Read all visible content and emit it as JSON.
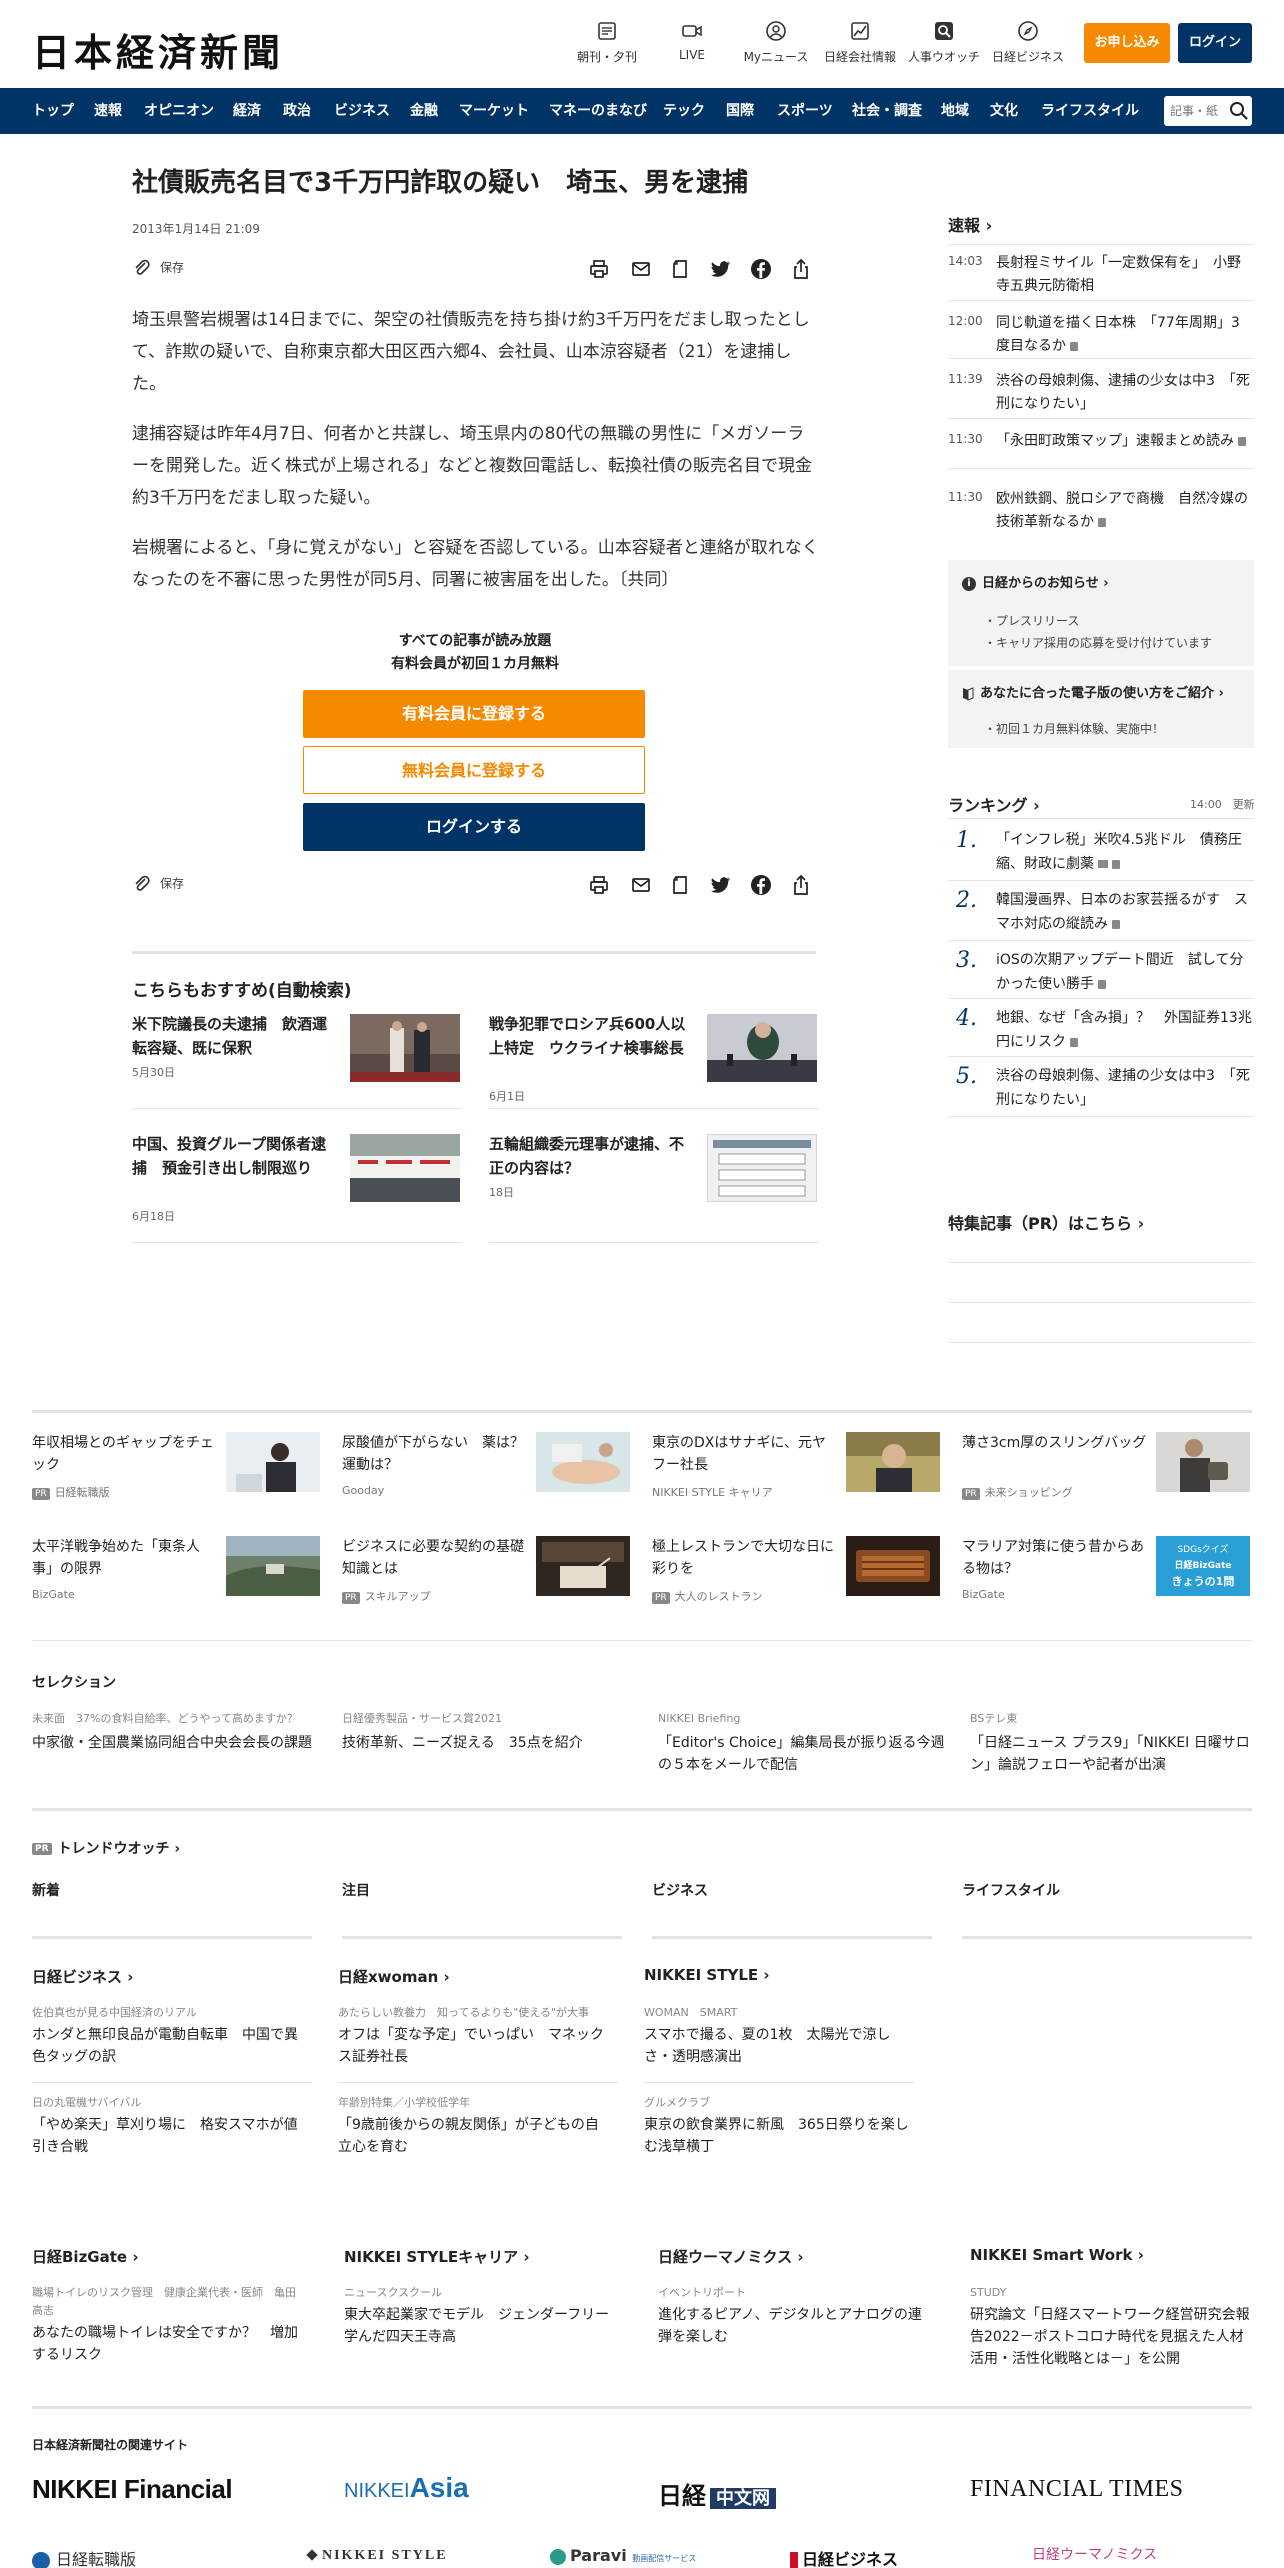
{
  "header": {
    "logo": "日本経済新聞",
    "icons": [
      {
        "label": "朝刊・夕刊",
        "icon": "newspaper-icon"
      },
      {
        "label": "LIVE",
        "icon": "video-icon"
      },
      {
        "label": "Myニュース",
        "icon": "user-icon"
      },
      {
        "label": "日経会社情報",
        "icon": "chart-icon"
      },
      {
        "label": "人事ウオッチ",
        "icon": "search-person-icon"
      },
      {
        "label": "日経ビジネス",
        "icon": "compass-icon"
      }
    ],
    "apply_label": "お申し込み",
    "login_label": "ログイン"
  },
  "nav": {
    "items": [
      "トップ",
      "速報",
      "オピニオン",
      "経済",
      "政治",
      "ビジネス",
      "金融",
      "マーケット",
      "マネーのまなび",
      "テック",
      "国際",
      "スポーツ",
      "社会・調査",
      "地域",
      "文化",
      "ライフスタイル"
    ],
    "search_placeholder": "記事・紙"
  },
  "article": {
    "title": "社債販売名目で3千万円詐取の疑い　埼玉、男を逮捕",
    "date": "2013年1月14日 21:09",
    "save_label": "保存",
    "paragraphs": [
      "埼玉県警岩槻署は14日までに、架空の社債販売を持ち掛け約3千万円をだまし取ったとして、詐欺の疑いで、自称東京都大田区西六郷4、会社員、山本涼容疑者（21）を逮捕した。",
      "逮捕容疑は昨年4月7日、何者かと共謀し、埼玉県内の80代の無職の男性に「メガソーラーを開発した。近く株式が上場される」などと複数回電話し、転換社債の販売名目で現金約3千万円をだまし取った疑い。",
      "岩槻署によると、「身に覚えがない」と容疑を否認している。山本容疑者と連絡が取れなくなったのを不審に思った男性が同5月、同署に被害届を出した。〔共同〕"
    ],
    "paywall_line1": "すべての記事が読み放題",
    "paywall_line2": "有料会員が初回１カ月無料",
    "paid_signup": "有料会員に登録する",
    "free_signup": "無料会員に登録する",
    "login": "ログインする"
  },
  "recommend": {
    "heading": "こちらもおすすめ(自動検索)",
    "items": [
      {
        "title": "米下院議長の夫逮捕　飲酒運転容疑、既に保釈",
        "date": "5月30日"
      },
      {
        "title": "戦争犯罪でロシア兵600人以上特定　ウクライナ検事総長",
        "date": "6月1日"
      },
      {
        "title": "中国、投資グループ関係者逮捕　預金引き出し制限巡り",
        "date": "6月18日"
      },
      {
        "title": "五輪組織委元理事が逮捕、不正の内容は？",
        "date": "18日"
      }
    ]
  },
  "sidebar": {
    "breaking_heading": "速報",
    "breaking": [
      {
        "time": "14:03",
        "text": "長射程ミサイル「一定数保有を」　小野寺五典元防衛相"
      },
      {
        "time": "12:00",
        "text": "同じ軌道を描く日本株　「77年周期」3度目なるか"
      },
      {
        "time": "11:39",
        "text": "渋谷の母娘刺傷、逮捕の少女は中3　「死刑になりたい」"
      },
      {
        "time": "11:30",
        "text": "「永田町政策マップ」速報まとめ読み"
      },
      {
        "time": "11:30",
        "text": "欧州鉄鋼、脱ロシアで商機　自然冷媒の技術革新なるか"
      }
    ],
    "notice_heading": "日経からのお知らせ",
    "notices": [
      "プレスリリース",
      "キャリア採用の応募を受け付けています"
    ],
    "edition_heading": "あなたに合った電子版の使い方をご紹介",
    "edition_items": [
      "初回１カ月無料体験、実施中！"
    ],
    "ranking_heading": "ランキング",
    "ranking_time": "14:00",
    "ranking_update": "更新",
    "ranking": [
      {
        "n": "1.",
        "text": "「インフレ税」米吹4.5兆ドル　債務圧縮、財政に劇薬"
      },
      {
        "n": "2.",
        "text": "韓国漫画界、日本のお家芸揺るがす　スマホ対応の縦読み"
      },
      {
        "n": "3.",
        "text": "iOSの次期アップデート間近　試して分かった使い勝手"
      },
      {
        "n": "4.",
        "text": "地銀、なぜ「含み損」？　外国証券13兆円にリスク"
      },
      {
        "n": "5.",
        "text": "渋谷の母娘刺傷、逮捕の少女は中3　「死刑になりたい」"
      }
    ],
    "pr_heading": "特集記事（PR）はこちら"
  },
  "ads": [
    {
      "title": "年収相場とのギャップをチェック",
      "source": "日経転職版",
      "pr": true
    },
    {
      "title": "尿酸値が下がらない　薬は？運動は？",
      "source": "Gooday",
      "pr": false
    },
    {
      "title": "東京のDXはサナギに、元ヤフー社長",
      "source": "NIKKEI STYLE キャリア",
      "pr": false
    },
    {
      "title": "薄さ3cm厚のスリングバッグ",
      "source": "未来ショッピング",
      "pr": true
    },
    {
      "title": "太平洋戦争始めた「東条人事」の限界",
      "source": "BizGate",
      "pr": false
    },
    {
      "title": "ビジネスに必要な契約の基礎知識とは",
      "source": "スキルアップ",
      "pr": true
    },
    {
      "title": "極上レストランで大切な日に彩りを",
      "source": "大人のレストラン",
      "pr": true
    },
    {
      "title": "マラリア対策に使う昔からある物は？",
      "source": "BizGate",
      "pr": false
    }
  ],
  "ad_badge": "PR",
  "ad_image_text": [
    "SDGsクイズ",
    "日経BizGate",
    "きょうの1問"
  ],
  "selection": {
    "heading": "セレクション",
    "items": [
      {
        "kicker": "未来面　37%の食料自給率、どうやって高めますか？",
        "title": "中家徹・全国農業協同組合中央会会長の課題"
      },
      {
        "kicker": "日経優秀製品・サービス賞2021",
        "title": "技術革新、ニーズ捉える　35点を紹介"
      },
      {
        "kicker": "NIKKEI Briefing",
        "title": "「Editor's Choice」編集局長が振り返る今週の５本をメールで配信"
      },
      {
        "kicker": "BSテレ東",
        "title": "「日経ニュース プラス9」「NIKKEI 日曜サロン」論説フェローや記者が出演"
      }
    ]
  },
  "trend": {
    "badge": "PR",
    "heading": "トレンドウオッチ",
    "columns": [
      "新着",
      "注目",
      "ビジネス",
      "ライフスタイル"
    ]
  },
  "blocks1": [
    {
      "heading": "日経ビジネス",
      "items": [
        {
          "kicker": "佐伯真也が見る中国経済のリアル",
          "title": "ホンダと無印良品が電動自転車　中国で異色タッグの訳"
        },
        {
          "kicker": "日の丸電機サバイバル",
          "title": "「やめ楽天」草刈り場に　格安スマホが値引き合戦"
        }
      ]
    },
    {
      "heading": "日経xwoman",
      "items": [
        {
          "kicker": "あたらしい教養力　知ってるよりも\"使える\"が大事",
          "title": "オフは「変な予定」でいっぱい　マネックス証券社長"
        },
        {
          "kicker": "年齢別特集／小学校低学年",
          "title": "「9歳前後からの親友関係」が子どもの自立心を育む"
        }
      ]
    },
    {
      "heading": "NIKKEI STYLE",
      "items": [
        {
          "kicker": "WOMAN　SMART",
          "title": "スマホで撮る、夏の1枚　太陽光で涼しさ・透明感演出"
        },
        {
          "kicker": "グルメクラブ",
          "title": "東京の飲食業界に新風　365日祭りを楽しむ浅草横丁"
        }
      ]
    }
  ],
  "blocks2": [
    {
      "heading": "日経BizGate",
      "kicker": "職場トイレのリスク管理　健康企業代表・医師　亀田高志",
      "title": "あなたの職場トイレは安全ですか？　増加するリスク"
    },
    {
      "heading": "NIKKEI STYLEキャリア",
      "kicker": "ニュースクスクール",
      "title": "東大卒起業家でモデル　ジェンダーフリー学んだ四天王寺高"
    },
    {
      "heading": "日経ウーマノミクス",
      "kicker": "イベントリポート",
      "title": "進化するピアノ、デジタルとアナログの連弾を楽しむ"
    },
    {
      "heading": "NIKKEI Smart Work",
      "kicker": "STUDY",
      "title": "研究論文「日経スマートワーク経営研究会報告2022－ポストコロナ時代を見据えた人材活用・活性化戦略とは－」を公開"
    }
  ],
  "related": {
    "heading": "日本経済新聞社の関連サイト",
    "brands": [
      "NIKKEI Financial",
      "NIKKEI Asia",
      "日経中文网",
      "FINANCIAL TIMES"
    ],
    "brand_nikkei_prefix": "NIKKEI",
    "brand_asia_suffix": "Asia",
    "brand_chinese_prefix": "日経",
    "brand_chinese_suffix": "中文网",
    "brands2": [
      "日経転職版",
      "NIKKEI STYLE",
      "Paravi",
      "日経ビジネス",
      "日経ウーマノミクス"
    ],
    "brand_paravi_sub": "動画配信サービス"
  },
  "colors": {
    "navy": "#003366",
    "orange": "#f58a00",
    "rank": "#003366"
  }
}
